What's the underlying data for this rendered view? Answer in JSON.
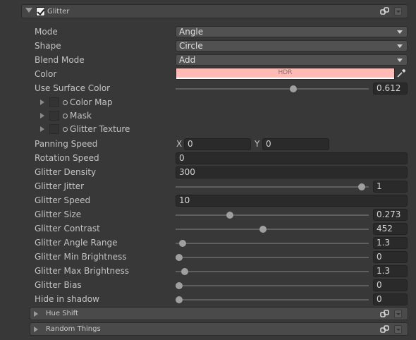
{
  "section": {
    "title": "Glitter",
    "enabled": true
  },
  "rows": {
    "mode": {
      "label": "Mode",
      "value": "Angle"
    },
    "shape": {
      "label": "Shape",
      "value": "Circle"
    },
    "blend_mode": {
      "label": "Blend Mode",
      "value": "Add"
    },
    "color": {
      "label": "Color",
      "hdr_text": "HDR",
      "value": "#ffbab6"
    },
    "use_surface_color": {
      "label": "Use Surface Color",
      "value": "0.612",
      "fraction": 0.612
    },
    "color_map": {
      "label": "Color Map"
    },
    "mask": {
      "label": "Mask"
    },
    "glitter_texture": {
      "label": "Glitter Texture"
    },
    "panning_speed": {
      "label": "Panning Speed",
      "x_label": "X",
      "x_value": "0",
      "y_label": "Y",
      "y_value": "0"
    },
    "rotation_speed": {
      "label": "Rotation Speed",
      "value": "0"
    },
    "glitter_density": {
      "label": "Glitter Density",
      "value": "300"
    },
    "glitter_jitter": {
      "label": "Glitter Jitter",
      "value": "1",
      "fraction": 0.98
    },
    "glitter_speed": {
      "label": "Glitter Speed",
      "value": "10"
    },
    "glitter_size": {
      "label": "Glitter Size",
      "value": "0.273",
      "fraction": 0.273
    },
    "glitter_contrast": {
      "label": "Glitter Contrast",
      "value": "452",
      "fraction": 0.45
    },
    "glitter_angle_range": {
      "label": "Glitter Angle Range",
      "value": "1.3",
      "fraction": 0.02
    },
    "glitter_min_brightness": {
      "label": "Glitter Min Brightness",
      "value": "0",
      "fraction": 0.0
    },
    "glitter_max_brightness": {
      "label": "Glitter Max Brightness",
      "value": "1.3",
      "fraction": 0.03
    },
    "glitter_bias": {
      "label": "Glitter Bias",
      "value": "0",
      "fraction": 0.0
    },
    "hide_in_shadow": {
      "label": "Hide in shadow",
      "value": "0",
      "fraction": 0.0
    }
  },
  "subsections": {
    "hue_shift": {
      "title": "Hue Shift"
    },
    "random_things": {
      "title": "Random Things"
    }
  }
}
